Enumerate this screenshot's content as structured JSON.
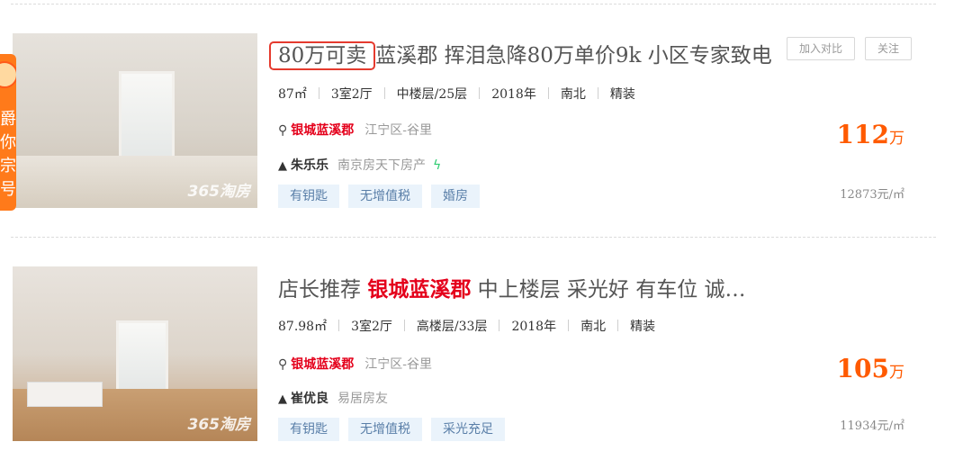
{
  "actions": {
    "compare_label": "加入对比",
    "follow_label": "关注"
  },
  "badge": {
    "text": "爵你宗号"
  },
  "listings": [
    {
      "title_boxed": "80万可卖",
      "title_rest": "蓝溪郡 挥泪急降80万单价9k 小区专家致电",
      "area": "87㎡",
      "layout": "3室2厅",
      "floor": "中楼层/25层",
      "year": "2018年",
      "orientation": "南北",
      "decoration": "精装",
      "community": "银城蓝溪郡",
      "district": "江宁区-谷里",
      "agent_name": "朱乐乐",
      "agent_company": "南京房天下房产",
      "tags": [
        "有钥匙",
        "无增值税",
        "婚房"
      ],
      "price_value": "112",
      "price_unit": "万",
      "unit_price": "12873元/㎡",
      "watermark": "365淘房"
    },
    {
      "title_prefix": "店长推荐",
      "title_highlight": "银城蓝溪郡",
      "title_rest": "中上楼层 采光好 有车位 诚…",
      "area": "87.98㎡",
      "layout": "3室2厅",
      "floor": "高楼层/33层",
      "year": "2018年",
      "orientation": "南北",
      "decoration": "精装",
      "community": "银城蓝溪郡",
      "district": "江宁区-谷里",
      "agent_name": "崔优良",
      "agent_company": "易居房友",
      "tags": [
        "有钥匙",
        "无增值税",
        "采光充足"
      ],
      "price_value": "105",
      "price_unit": "万",
      "unit_price": "11934元/㎡",
      "watermark": "365淘房"
    }
  ]
}
